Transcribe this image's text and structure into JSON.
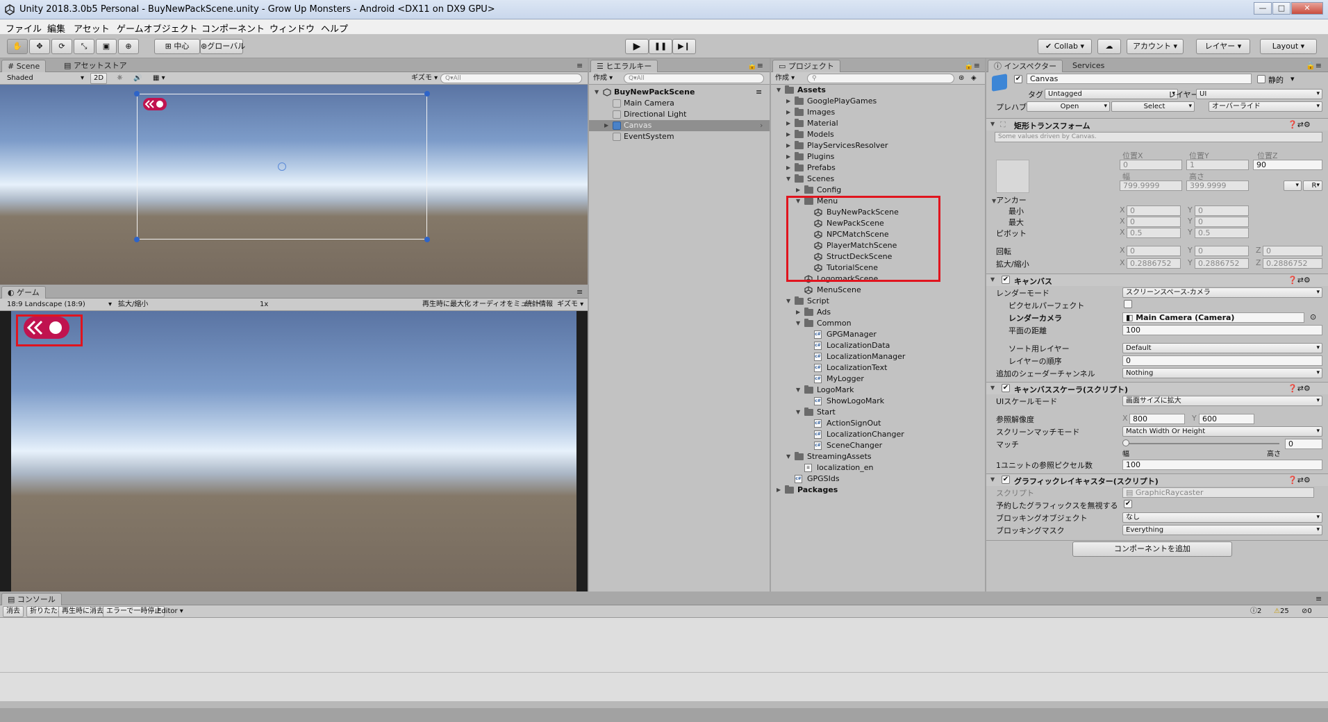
{
  "window": {
    "title": "Unity 2018.3.0b5 Personal - BuyNewPackScene.unity - Grow Up Monsters - Android <DX11 on DX9 GPU>",
    "controls": [
      "—",
      "□",
      "✕"
    ]
  },
  "menu": [
    "ファイル",
    "編集",
    "アセット",
    "ゲームオブジェクト",
    "コンポーネント",
    "ウィンドウ",
    "ヘルプ"
  ],
  "toolbar": {
    "pivot": "中心",
    "space": "グローバル",
    "collab": "Collab",
    "account": "アカウント",
    "layers": "レイヤー",
    "layout": "Layout"
  },
  "scene": {
    "tabs": [
      "Scene",
      "アセットストア"
    ],
    "shading": "Shaded",
    "mode2d": "2D",
    "gizmos": "ギズモ",
    "search": "Q▾All"
  },
  "game": {
    "tab": "ゲーム",
    "resolution": "18:9 Landscape (18:9)",
    "scale_label": "拡大/縮小",
    "scale_value": "1x",
    "options": [
      "再生時に最大化",
      "オーディオをミュート",
      "統計情報",
      "ギズモ"
    ]
  },
  "hierarchy": {
    "tab": "ヒエラルキー",
    "create": "作成",
    "search": "Q▾All",
    "scene": "BuyNewPackScene",
    "items": [
      "Main Camera",
      "Directional Light",
      "Canvas",
      "EventSystem"
    ]
  },
  "project": {
    "tab": "プロジェクト",
    "create": "作成",
    "tree": [
      {
        "label": "Assets",
        "depth": 0,
        "type": "folder",
        "open": true,
        "bold": true
      },
      {
        "label": "GooglePlayGames",
        "depth": 1,
        "type": "folder"
      },
      {
        "label": "Images",
        "depth": 1,
        "type": "folder"
      },
      {
        "label": "Material",
        "depth": 1,
        "type": "folder"
      },
      {
        "label": "Models",
        "depth": 1,
        "type": "folder"
      },
      {
        "label": "PlayServicesResolver",
        "depth": 1,
        "type": "folder"
      },
      {
        "label": "Plugins",
        "depth": 1,
        "type": "folder"
      },
      {
        "label": "Prefabs",
        "depth": 1,
        "type": "folder"
      },
      {
        "label": "Scenes",
        "depth": 1,
        "type": "folder",
        "open": true
      },
      {
        "label": "Config",
        "depth": 2,
        "type": "folder"
      },
      {
        "label": "Menu",
        "depth": 2,
        "type": "folder",
        "open": true
      },
      {
        "label": "BuyNewPackScene",
        "depth": 3,
        "type": "scene"
      },
      {
        "label": "NewPackScene",
        "depth": 3,
        "type": "scene"
      },
      {
        "label": "NPCMatchScene",
        "depth": 3,
        "type": "scene"
      },
      {
        "label": "PlayerMatchScene",
        "depth": 3,
        "type": "scene"
      },
      {
        "label": "StructDeckScene",
        "depth": 3,
        "type": "scene"
      },
      {
        "label": "TutorialScene",
        "depth": 3,
        "type": "scene"
      },
      {
        "label": "LogomarkScene",
        "depth": 2,
        "type": "scene"
      },
      {
        "label": "MenuScene",
        "depth": 2,
        "type": "scene"
      },
      {
        "label": "Script",
        "depth": 1,
        "type": "folder",
        "open": true
      },
      {
        "label": "Ads",
        "depth": 2,
        "type": "folder"
      },
      {
        "label": "Common",
        "depth": 2,
        "type": "folder",
        "open": true
      },
      {
        "label": "GPGManager",
        "depth": 3,
        "type": "script"
      },
      {
        "label": "LocalizationData",
        "depth": 3,
        "type": "script"
      },
      {
        "label": "LocalizationManager",
        "depth": 3,
        "type": "script"
      },
      {
        "label": "LocalizationText",
        "depth": 3,
        "type": "script"
      },
      {
        "label": "MyLogger",
        "depth": 3,
        "type": "script"
      },
      {
        "label": "LogoMark",
        "depth": 2,
        "type": "folder",
        "open": true
      },
      {
        "label": "ShowLogoMark",
        "depth": 3,
        "type": "script"
      },
      {
        "label": "Start",
        "depth": 2,
        "type": "folder",
        "open": true
      },
      {
        "label": "ActionSignOut",
        "depth": 3,
        "type": "script"
      },
      {
        "label": "LocalizationChanger",
        "depth": 3,
        "type": "script"
      },
      {
        "label": "SceneChanger",
        "depth": 3,
        "type": "script"
      },
      {
        "label": "StreamingAssets",
        "depth": 1,
        "type": "folder",
        "open": true
      },
      {
        "label": "localization_en",
        "depth": 2,
        "type": "file"
      },
      {
        "label": "GPGSIds",
        "depth": 1,
        "type": "script"
      },
      {
        "label": "Packages",
        "depth": 0,
        "type": "folder",
        "bold": true
      }
    ]
  },
  "inspector": {
    "tabs": [
      "インスペクター",
      "Services"
    ],
    "object_name": "Canvas",
    "static_label": "静的",
    "tag_label": "タグ",
    "tag_value": "Untagged",
    "layer_label": "レイヤー",
    "layer_value": "UI",
    "prefab_label": "プレハブ",
    "prefab_open": "Open",
    "prefab_select": "Select",
    "prefab_override": "オーバーライド",
    "rect": {
      "title": "矩形トランスフォーム",
      "note": "Some values driven by Canvas.",
      "pos_x_label": "位置X",
      "pos_y_label": "位置Y",
      "pos_z_label": "位置Z",
      "pos_x": "0",
      "pos_y": "1",
      "pos_z": "90",
      "width_label": "幅",
      "height_label": "高さ",
      "width": "799.9999",
      "height": "399.9999",
      "anchor_label": "アンカー",
      "min_label": "最小",
      "max_label": "最大",
      "min_x": "0",
      "min_y": "0",
      "max_x": "0",
      "max_y": "0",
      "pivot_label": "ピボット",
      "pivot_x": "0.5",
      "pivot_y": "0.5",
      "rotation_label": "回転",
      "rot_x": "0",
      "rot_y": "0",
      "rot_z": "0",
      "scale_label": "拡大/縮小",
      "scale_x": "0.2886752",
      "scale_y": "0.2886752",
      "scale_z": "0.2886752",
      "r_button": "R"
    },
    "canvas": {
      "title": "キャンバス",
      "render_mode_label": "レンダーモード",
      "render_mode": "スクリーンスペース-カメラ",
      "pixel_perfect_label": "ピクセルパーフェクト",
      "render_camera_label": "レンダーカメラ",
      "render_camera": "Main Camera (Camera)",
      "plane_distance_label": "平面の距離",
      "plane_distance": "100",
      "sorting_layer_label": "ソート用レイヤー",
      "sorting_layer": "Default",
      "order_label": "レイヤーの順序",
      "order": "0",
      "shader_channels_label": "追加のシェーダーチャンネル",
      "shader_channels": "Nothing"
    },
    "scaler": {
      "title": "キャンバススケーラ(スクリプト)",
      "ui_scale_label": "UIスケールモード",
      "ui_scale": "画面サイズに拡大",
      "ref_res_label": "参照解像度",
      "ref_x": "800",
      "ref_y": "600",
      "match_mode_label": "スクリーンマッチモード",
      "match_mode": "Match Width Or Height",
      "match_label": "マッチ",
      "match_value": "0",
      "match_fraction": 0,
      "match_width": "幅",
      "match_height": "高さ",
      "ppu_label": "1ユニットの参照ピクセル数",
      "ppu": "100"
    },
    "raycaster": {
      "title": "グラフィックレイキャスター(スクリプト)",
      "script_label": "スクリプト",
      "script": "GraphicRaycaster",
      "ignore_label": "予約したグラフィックスを無視する",
      "blocking_obj_label": "ブロッキングオブジェクト",
      "blocking_obj": "なし",
      "blocking_mask_label": "ブロッキングマスク",
      "blocking_mask": "Everything"
    },
    "add_component": "コンポーネントを追加"
  },
  "console": {
    "tab": "コンソール",
    "buttons": [
      "消去",
      "折りたたみ",
      "再生時に消去",
      "エラーで一時停止",
      "Editor"
    ],
    "counts": {
      "info": "2",
      "warn": "25",
      "error": "0"
    }
  },
  "colors": {
    "highlight": "#e0141e",
    "canvas_rect": "#f2f2f2",
    "handle": "#2e64c8",
    "badge": "#c0134f"
  }
}
